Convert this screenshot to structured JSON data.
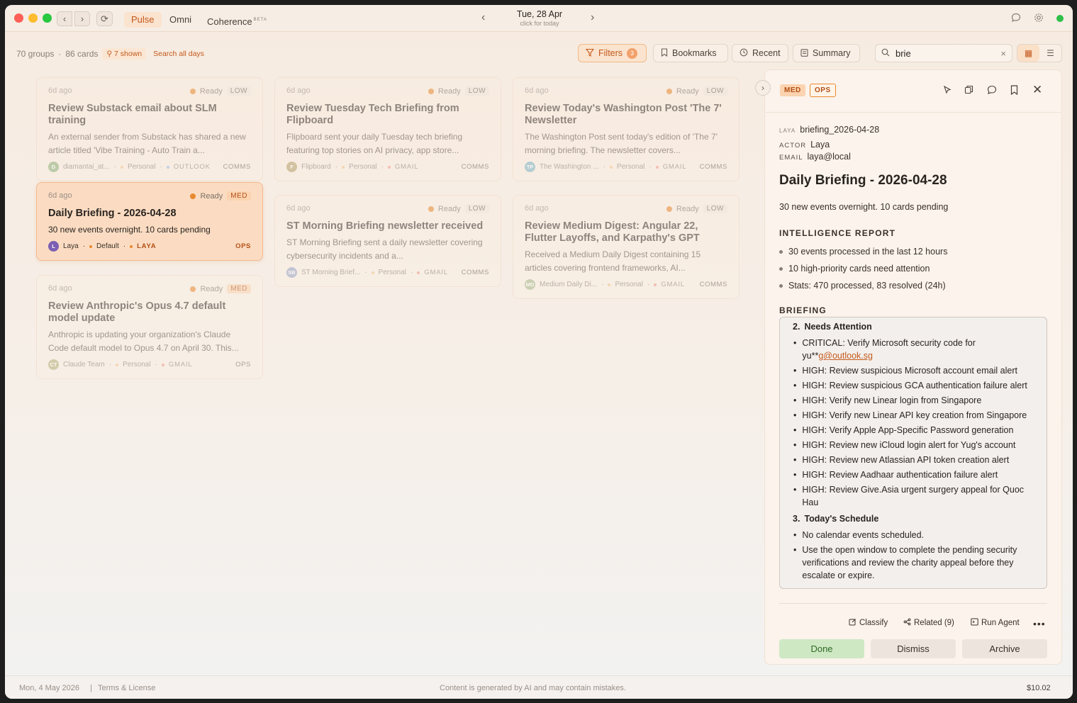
{
  "nav": {
    "tabs": [
      {
        "label": "Pulse",
        "active": true
      },
      {
        "label": "Omni"
      },
      {
        "label": "Coherence",
        "sup": "BETA"
      }
    ],
    "date": "Tue, 28 Apr",
    "date_hint": "click for today"
  },
  "toolbar": {
    "groups": "70 groups",
    "cards": "86 cards",
    "shown": "7 shown",
    "search_all": "Search all days",
    "filters_label": "Filters",
    "filters_count": "3",
    "bookmarks_label": "Bookmarks",
    "recent_label": "Recent",
    "summary_label": "Summary",
    "search_value": "brie"
  },
  "cards": [
    {
      "age": "6d ago",
      "status": "Ready",
      "priority": "LOW",
      "title": "Review Substack email about SLM training",
      "body": "An external sender from Substack has shared a new article titled 'Vibe Training - Auto Train a...",
      "avatar": "D",
      "avatar_color": "#8fb07a",
      "author": "diamantai_at...",
      "context": "Personal",
      "context_dot": "#f2c48a",
      "source": "OUTLOOK",
      "source_dot": "#9bb8e8",
      "category": "COMMS"
    },
    {
      "age": "6d ago",
      "status": "Ready",
      "priority": "LOW",
      "title": "Review Tuesday Tech Briefing from Flipboard",
      "body": "Flipboard sent your daily Tuesday tech briefing featuring top stories on AI privacy, app store...",
      "avatar": "F",
      "avatar_color": "#b7a06a",
      "author": "Flipboard",
      "context": "Personal",
      "context_dot": "#f2c48a",
      "source": "GMAIL",
      "source_dot": "#f09a8a",
      "category": "COMMS"
    },
    {
      "age": "6d ago",
      "status": "Ready",
      "priority": "LOW",
      "title": "Review Today's Washington Post 'The 7' Newsletter",
      "body": "The Washington Post sent today's edition of 'The 7' morning briefing. The newsletter covers...",
      "avatar": "TP",
      "avatar_color": "#7fb3c4",
      "author": "The Washington ...",
      "context": "Personal",
      "context_dot": "#f2c48a",
      "source": "GMAIL",
      "source_dot": "#f09a8a",
      "category": "COMMS"
    },
    {
      "age": "6d ago",
      "status": "Ready",
      "priority": "MED",
      "title": "Daily Briefing - 2026-04-28",
      "body": "30 new events overnight. 10 cards pending",
      "avatar": "L",
      "avatar_color": "#7b5fb3",
      "author": "Laya",
      "context": "Default",
      "context_dot": "#e8892f",
      "source": "LAYA",
      "source_dot": "#e8892f",
      "category": "OPS"
    },
    {
      "age": "6d ago",
      "status": "Ready",
      "priority": "LOW",
      "title": "ST Morning Briefing newsletter received",
      "body": "ST Morning Briefing sent a daily newsletter covering cybersecurity incidents and a...",
      "avatar": "SB",
      "avatar_color": "#9aa3c4",
      "author": "ST Morning Brief...",
      "context": "Personal",
      "context_dot": "#f2c48a",
      "source": "GMAIL",
      "source_dot": "#f09a8a",
      "category": "COMMS"
    },
    {
      "age": "6d ago",
      "status": "Ready",
      "priority": "LOW",
      "title": "Review Medium Digest: Angular 22, Flutter Layoffs, and Karpathy's GPT",
      "body": "Received a Medium Daily Digest containing 15 articles covering frontend frameworks, AI...",
      "avatar": "MD",
      "avatar_color": "#a9b88a",
      "author": "Medium Daily Di...",
      "context": "Personal",
      "context_dot": "#f2c48a",
      "source": "GMAIL",
      "source_dot": "#f09a8a",
      "category": "COMMS"
    },
    {
      "age": "6d ago",
      "status": "Ready",
      "priority": "MED",
      "title": "Review Anthropic's Opus 4.7 default model update",
      "body": "Anthropic is updating your organization's Claude Code default model to Opus 4.7 on April 30. This...",
      "avatar": "CT",
      "avatar_color": "#b8b07a",
      "author": "Claude Team",
      "context": "Personal",
      "context_dot": "#f2c48a",
      "source": "GMAIL",
      "source_dot": "#f09a8a",
      "category": "OPS"
    }
  ],
  "panel": {
    "priority": "MED",
    "category": "OPS",
    "meta_source_key": "LAYA",
    "meta_source_val": "briefing_2026-04-28",
    "actor_key": "ACTOR",
    "actor_val": "Laya",
    "email_key": "EMAIL",
    "email_val": "laya@local",
    "title": "Daily Briefing - 2026-04-28",
    "subtitle": "30 new events overnight. 10 cards pending",
    "intel_heading": "INTELLIGENCE REPORT",
    "intel": [
      "30 events processed in the last 12 hours",
      "10 high-priority cards need attention",
      "Stats: 470 processed, 83 resolved (24h)"
    ],
    "briefing_heading": "BRIEFING",
    "section2_num": "2.",
    "section2_title": "Needs Attention",
    "critical_text": "CRITICAL: Verify Microsoft security code for yu**",
    "critical_link": "g@outlook.sg",
    "attention": [
      "HIGH: Review suspicious Microsoft account email alert",
      "HIGH: Review suspicious GCA authentication failure alert",
      "HIGH: Verify new Linear login from Singapore",
      "HIGH: Verify new Linear API key creation from Singapore",
      "HIGH: Verify Apple App-Specific Password generation",
      "HIGH: Review new iCloud login alert for Yug's account",
      "HIGH: Review new Atlassian API token creation alert",
      "HIGH: Review Aadhaar authentication failure alert",
      "HIGH: Review Give.Asia urgent surgery appeal for Quoc Hau"
    ],
    "section3_num": "3.",
    "section3_title": "Today's Schedule",
    "schedule": [
      "No calendar events scheduled.",
      "Use the open window to complete the pending security verifications and review the charity appeal before they escalate or expire."
    ],
    "classify_label": "Classify",
    "related_label": "Related (9)",
    "run_agent_label": "Run Agent",
    "done_label": "Done",
    "dismiss_label": "Dismiss",
    "archive_label": "Archive"
  },
  "footer": {
    "date": "Mon, 4 May 2026",
    "sep": "|",
    "terms": "Terms & License",
    "disclaimer": "Content is generated by AI and may contain mistakes.",
    "cost": "$10.02"
  },
  "colors": {
    "accent": "#c4591c",
    "done_bg": "#cfe8c4",
    "done_fg": "#2f6a25",
    "close": "#ff5f57",
    "minimize": "#febc2e",
    "zoom": "#28c840"
  }
}
